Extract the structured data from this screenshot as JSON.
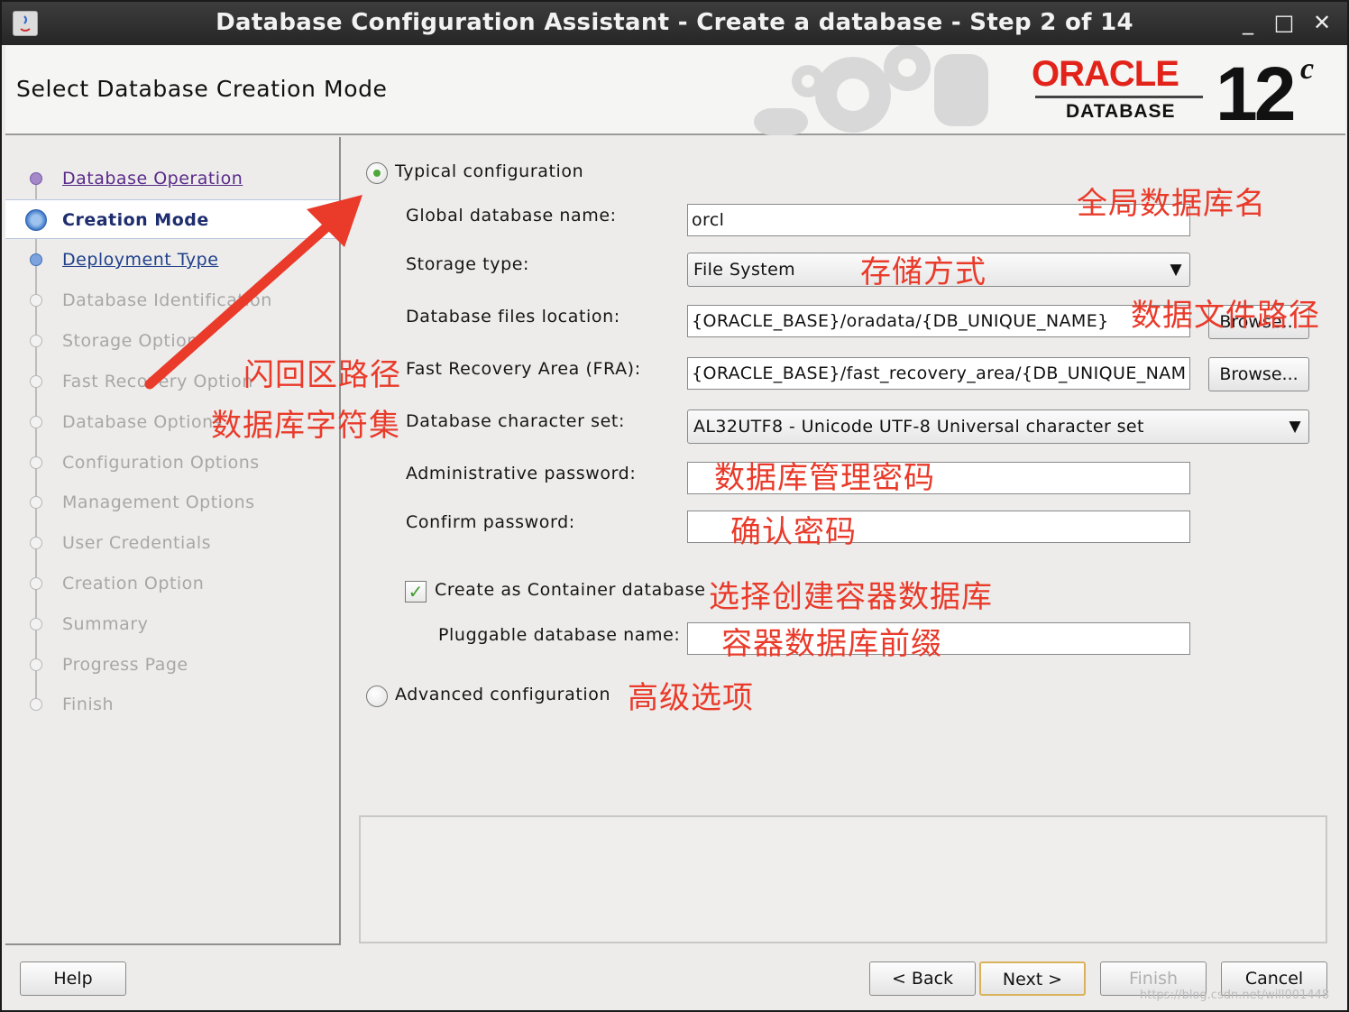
{
  "window": {
    "title": "Database Configuration Assistant - Create a database - Step 2 of 14",
    "minimize": "_",
    "maximize": "□",
    "close": "✕"
  },
  "header": {
    "page_title": "Select Database Creation Mode",
    "brand_word": "ORACLE",
    "brand_db": "DATABASE",
    "brand_version": "12",
    "brand_version_suffix": "c"
  },
  "nav": {
    "items": [
      {
        "label": "Database Operation",
        "state": "done"
      },
      {
        "label": "Creation Mode",
        "state": "current"
      },
      {
        "label": "Deployment Type",
        "state": "next"
      },
      {
        "label": "Database Identification",
        "state": "disabled"
      },
      {
        "label": "Storage Option",
        "state": "disabled"
      },
      {
        "label": "Fast Recovery Option",
        "state": "disabled"
      },
      {
        "label": "Database Options",
        "state": "disabled"
      },
      {
        "label": "Configuration Options",
        "state": "disabled"
      },
      {
        "label": "Management Options",
        "state": "disabled"
      },
      {
        "label": "User Credentials",
        "state": "disabled"
      },
      {
        "label": "Creation Option",
        "state": "disabled"
      },
      {
        "label": "Summary",
        "state": "disabled"
      },
      {
        "label": "Progress Page",
        "state": "disabled"
      },
      {
        "label": "Finish",
        "state": "disabled"
      }
    ]
  },
  "form": {
    "typical_label": "Typical configuration",
    "typical_selected": true,
    "global_db_name_label": "Global database name:",
    "global_db_name_value": "orcl",
    "storage_type_label": "Storage type:",
    "storage_type_value": "File System",
    "db_files_location_label": "Database files location:",
    "db_files_location_value": "{ORACLE_BASE}/oradata/{DB_UNIQUE_NAME}",
    "fra_label": "Fast Recovery Area (FRA):",
    "fra_value": "{ORACLE_BASE}/fast_recovery_area/{DB_UNIQUE_NAM",
    "browse_label": "Browse...",
    "charset_label": "Database character set:",
    "charset_value": "AL32UTF8 - Unicode UTF-8 Universal character set",
    "admin_password_label": "Administrative password:",
    "admin_password_value": "",
    "confirm_password_label": "Confirm password:",
    "confirm_password_value": "",
    "container_label": "Create as Container database",
    "container_checked": true,
    "pluggable_label": "Pluggable database name:",
    "pluggable_value": "",
    "advanced_label": "Advanced configuration",
    "advanced_selected": false
  },
  "annotations": {
    "global_name": "全局数据库名",
    "storage": "存储方式",
    "files_path": "数据文件路径",
    "fra": "闪回区路径",
    "charset": "数据库字符集",
    "admin_pw": "数据库管理密码",
    "confirm_pw": "确认密码",
    "container": "选择创建容器数据库",
    "pluggable": "容器数据库前缀",
    "advanced": "高级选项",
    "color": "#e93a2a"
  },
  "footer": {
    "help": "Help",
    "back": "< Back",
    "next": "Next >",
    "finish": "Finish",
    "cancel": "Cancel"
  },
  "watermark": "https://blog.csdn.net/will001448"
}
